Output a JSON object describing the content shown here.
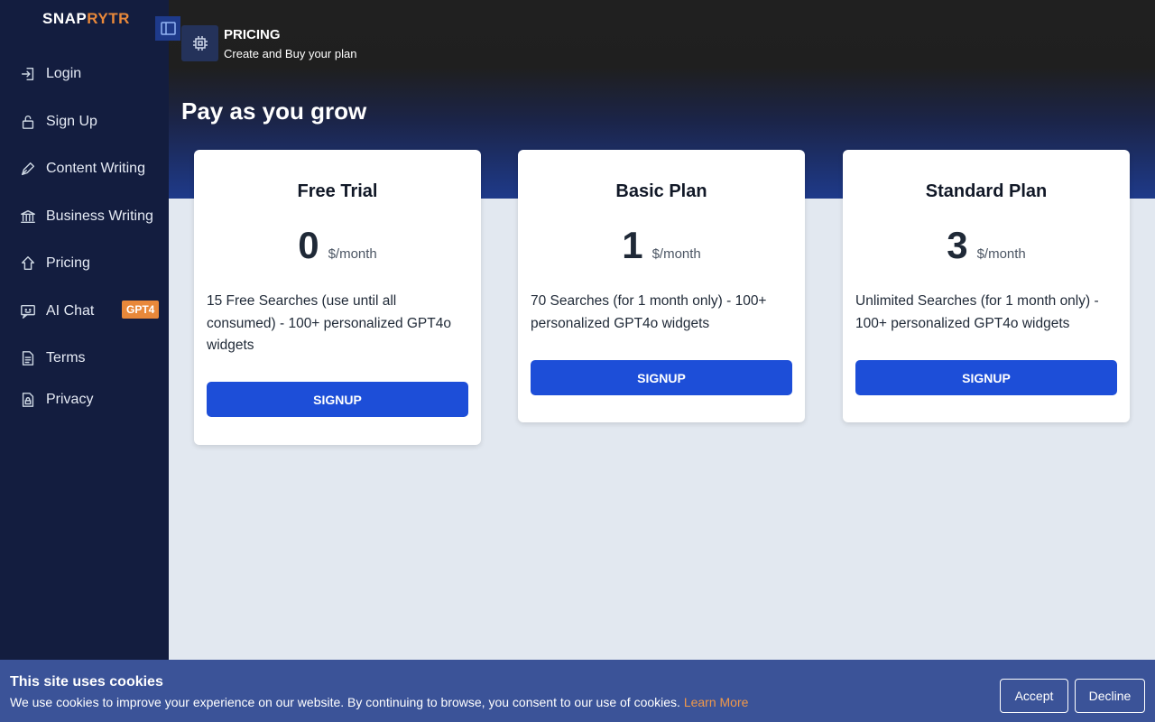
{
  "brand": {
    "part1": "SNAP",
    "part2": "RYTR"
  },
  "sidebar": {
    "items": [
      {
        "label": "Login",
        "icon": "login-icon"
      },
      {
        "label": "Sign Up",
        "icon": "unlock-icon"
      },
      {
        "label": "Content Writing",
        "icon": "pen-icon"
      },
      {
        "label": "Business Writing",
        "icon": "bank-icon"
      },
      {
        "label": "Pricing",
        "icon": "tag-icon"
      },
      {
        "label": "AI Chat",
        "icon": "chat-icon",
        "badge": "GPT4"
      },
      {
        "label": "Terms",
        "icon": "document-icon"
      },
      {
        "label": "Privacy",
        "icon": "document-lock-icon"
      }
    ]
  },
  "header": {
    "title": "PRICING",
    "subtitle": "Create and Buy your plan",
    "icon": "chip-icon"
  },
  "main": {
    "heading": "Pay as you grow",
    "plans": [
      {
        "name": "Free Trial",
        "price": "0",
        "unit": "$/month",
        "description": "15 Free Searches (use until all consumed) - 100+ personalized GPT4o widgets",
        "button": "SIGNUP"
      },
      {
        "name": "Basic Plan",
        "price": "1",
        "unit": "$/month",
        "description": "70 Searches (for 1 month only) - 100+ personalized GPT4o widgets",
        "button": "SIGNUP"
      },
      {
        "name": "Standard Plan",
        "price": "3",
        "unit": "$/month",
        "description": "Unlimited Searches (for 1 month only) - 100+ personalized GPT4o widgets",
        "button": "SIGNUP"
      }
    ]
  },
  "cookie": {
    "title": "This site uses cookies",
    "text": "We use cookies to improve your experience on our website. By continuing to browse, you consent to our use of cookies.",
    "link": "Learn More",
    "accept": "Accept",
    "decline": "Decline"
  },
  "colors": {
    "accent": "#1d4ed8",
    "brand_orange": "#e8883a",
    "sidebar_bg": "#131d3f",
    "cookie_bg": "#3b5398"
  }
}
